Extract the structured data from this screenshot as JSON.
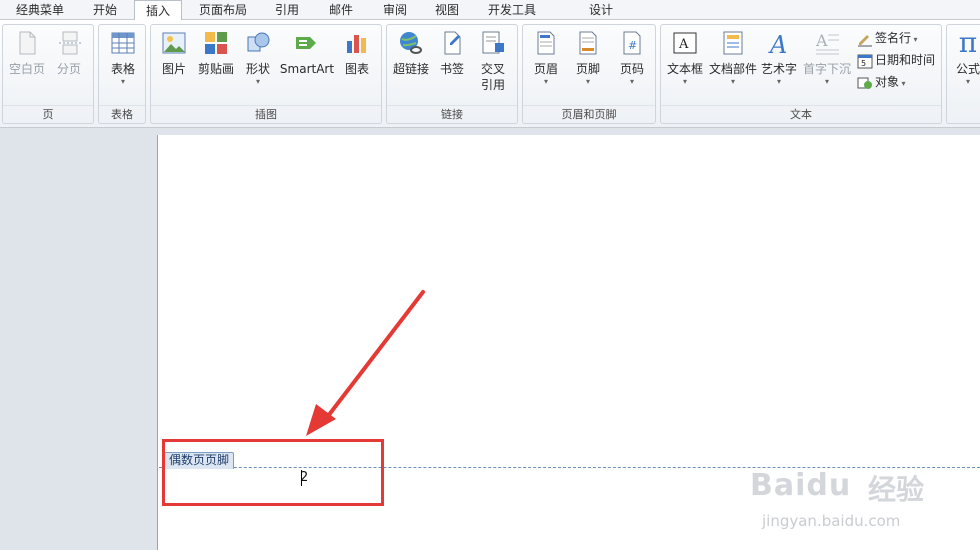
{
  "tabs": [
    {
      "label": "经典菜单"
    },
    {
      "label": "开始"
    },
    {
      "label": "插入"
    },
    {
      "label": "页面布局"
    },
    {
      "label": "引用"
    },
    {
      "label": "邮件"
    },
    {
      "label": "审阅"
    },
    {
      "label": "视图"
    },
    {
      "label": "开发工具"
    },
    {
      "label": "设计"
    }
  ],
  "active_tab": "插入",
  "groups": {
    "page": {
      "label": "页",
      "buttons": [
        {
          "label": "空白页",
          "icon": "blank-page-icon"
        },
        {
          "label": "分页",
          "icon": "page-break-icon"
        }
      ]
    },
    "table": {
      "label": "表格",
      "buttons": [
        {
          "label": "表格",
          "icon": "table-icon"
        }
      ]
    },
    "illustrations": {
      "label": "插图",
      "buttons": [
        {
          "label": "图片",
          "icon": "picture-icon"
        },
        {
          "label": "剪贴画",
          "icon": "clipart-icon"
        },
        {
          "label": "形状",
          "icon": "shapes-icon"
        },
        {
          "label": "SmartArt",
          "icon": "smartart-icon"
        },
        {
          "label": "图表",
          "icon": "chart-icon"
        }
      ]
    },
    "links": {
      "label": "链接",
      "buttons": [
        {
          "label": "超链接",
          "icon": "hyperlink-icon"
        },
        {
          "label": "书签",
          "icon": "bookmark-icon"
        },
        {
          "label": "交叉",
          "label2": "引用",
          "icon": "cross-reference-icon"
        }
      ]
    },
    "header_footer": {
      "label": "页眉和页脚",
      "buttons": [
        {
          "label": "页眉",
          "icon": "header-icon"
        },
        {
          "label": "页脚",
          "icon": "footer-icon"
        },
        {
          "label": "页码",
          "icon": "page-number-icon"
        }
      ]
    },
    "text": {
      "label": "文本",
      "buttons": [
        {
          "label": "文本框",
          "icon": "textbox-icon"
        },
        {
          "label": "文档部件",
          "icon": "quick-parts-icon"
        },
        {
          "label": "艺术字",
          "icon": "wordart-icon"
        },
        {
          "label": "首字下沉",
          "icon": "drop-cap-icon"
        }
      ],
      "small": [
        {
          "label": "签名行",
          "icon": "signature-line-icon"
        },
        {
          "label": "日期和时间",
          "icon": "date-time-icon"
        },
        {
          "label": "对象",
          "icon": "object-icon"
        }
      ]
    },
    "symbols": {
      "buttons": [
        {
          "label": "公式",
          "icon": "equation-icon",
          "glyph": "π"
        }
      ]
    }
  },
  "document": {
    "footer_tab_label": "偶数页页脚",
    "page_number": "2"
  },
  "colors": {
    "highlight": "#e53935",
    "accent": "#2b579a"
  },
  "watermark": {
    "logo": "Baidu",
    "cn": "经验",
    "url": "jingyan.baidu.com"
  }
}
